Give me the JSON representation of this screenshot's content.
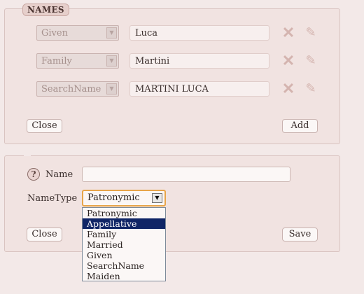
{
  "names_panel": {
    "legend": "NAMES",
    "rows": [
      {
        "type": "Given",
        "value": "Luca",
        "delete_icon": "delete-x-icon",
        "edit_icon": "pencil-icon"
      },
      {
        "type": "Family",
        "value": "Martini",
        "delete_icon": "delete-x-icon",
        "edit_icon": "pencil-icon"
      },
      {
        "type": "SearchName",
        "value": "MARTINI LUCA",
        "delete_icon": "delete-x-icon",
        "edit_icon": "pencil-icon"
      }
    ],
    "close_label": "Close",
    "add_label": "Add"
  },
  "edit_panel": {
    "help_symbol": "?",
    "name_label": "Name",
    "name_value": "",
    "nametype_label": "NameType",
    "nametype_selected": "Patronymic",
    "nametype_options": [
      "Patronymic",
      "Appellative",
      "Family",
      "Married",
      "Given",
      "SearchName",
      "Maiden"
    ],
    "highlighted_option": "Appellative",
    "close_label": "Close",
    "save_label": "Save"
  },
  "colors": {
    "background": "#f3e9e8",
    "panel": "#f1e3e1",
    "icon": "#d4b4af",
    "highlight": "#0f2566",
    "focus_border": "#e7a54a"
  }
}
